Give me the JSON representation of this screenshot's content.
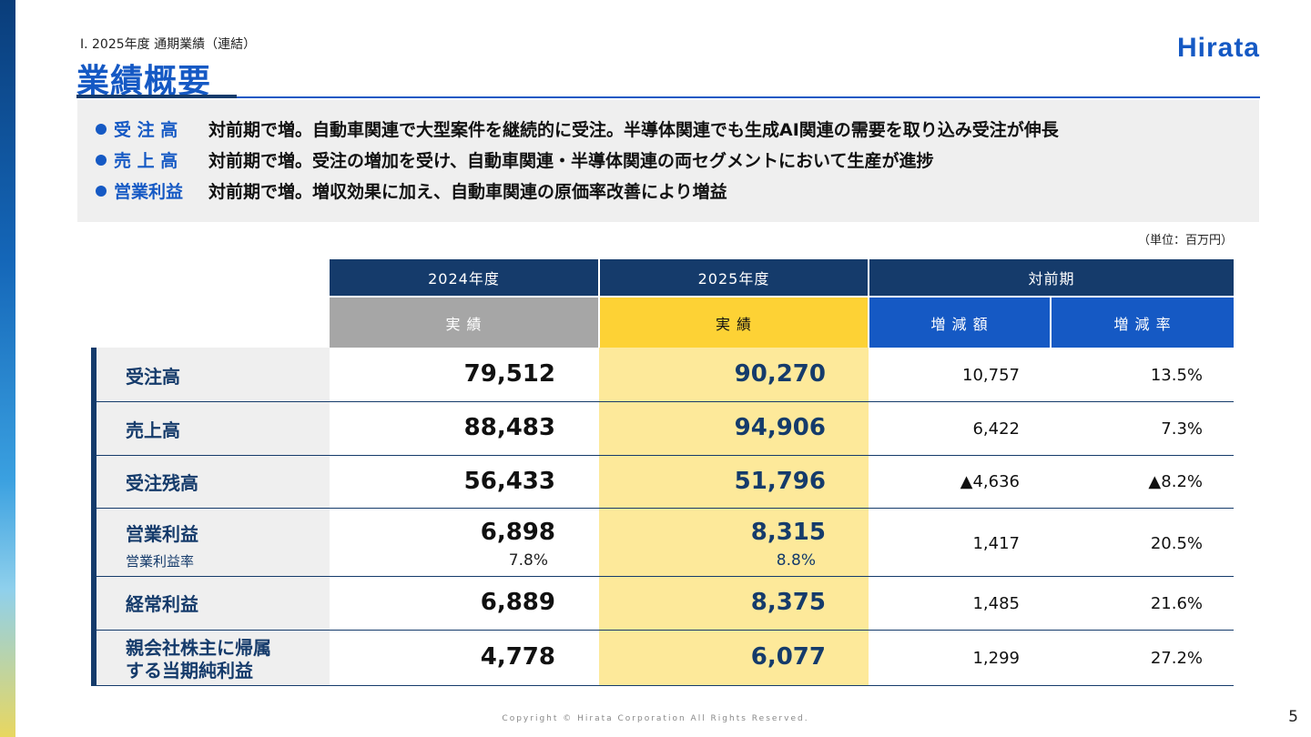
{
  "header": {
    "section": "Ⅰ. 2025年度 通期業績（連結）",
    "title": "業績概要",
    "logo": "Hirata"
  },
  "summary": [
    {
      "label": "受 注 高",
      "text": "対前期で増。自動車関連で大型案件を継続的に受注。半導体関連でも生成AI関連の需要を取り込み受注が伸長"
    },
    {
      "label": "売 上 高",
      "text": "対前期で増。受注の増加を受け、自動車関連・半導体関連の両セグメントにおいて生産が進捗"
    },
    {
      "label": "営業利益",
      "text": "対前期で増。増収効果に加え、自動車関連の原価率改善により増益"
    }
  ],
  "unit_note": "（単位：百万円）",
  "table": {
    "header_top": [
      "2024年度",
      "2025年度",
      "対前期"
    ],
    "header_sub": [
      "実 績",
      "実 績",
      "増 減 額",
      "増 減 率"
    ],
    "rows": [
      {
        "label": "受注高",
        "v2024": "79,512",
        "v2025": "90,270",
        "diff": "10,757",
        "rate": "13.5%"
      },
      {
        "label": "売上高",
        "v2024": "88,483",
        "v2025": "94,906",
        "diff": "6,422",
        "rate": "7.3%"
      },
      {
        "label": "受注残高",
        "v2024": "56,433",
        "v2025": "51,796",
        "diff": "▲4,636",
        "rate": "▲8.2%"
      },
      {
        "label": "営業利益",
        "sublabel": "営業利益率",
        "v2024": "6,898",
        "v2025": "8,315",
        "p2024": "7.8%",
        "p2025": "8.8%",
        "diff": "1,417",
        "rate": "20.5%"
      },
      {
        "label": "経常利益",
        "v2024": "6,889",
        "v2025": "8,375",
        "diff": "1,485",
        "rate": "21.6%"
      },
      {
        "label_line1": "親会社株主に帰属",
        "label_line2": "する当期純利益",
        "v2024": "4,778",
        "v2025": "6,077",
        "diff": "1,299",
        "rate": "27.2%"
      }
    ]
  },
  "colors": {
    "accent": "#1559c4",
    "navy": "#153b6b",
    "highlight": "#fde99a",
    "gold_header": "#fdd235",
    "gray_header": "#a6a6a6"
  },
  "footer": {
    "copyright": "Copyright © Hirata Corporation All Rights Reserved.",
    "page_number": "5"
  }
}
